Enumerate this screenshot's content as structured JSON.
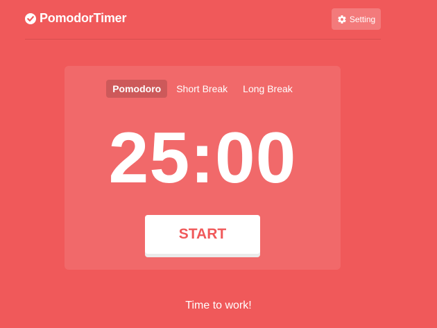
{
  "app": {
    "name": "PomodorTimer",
    "logo_icon": "check-circle-icon"
  },
  "header": {
    "settings_label": "Setting",
    "settings_icon": "gear-icon"
  },
  "tabs": [
    {
      "label": "Pomodoro",
      "active": true
    },
    {
      "label": "Short Break",
      "active": false
    },
    {
      "label": "Long Break",
      "active": false
    }
  ],
  "timer": {
    "display": "25:00"
  },
  "controls": {
    "start_label": "START"
  },
  "status": {
    "message": "Time to work!"
  },
  "colors": {
    "background": "#F0595A",
    "button_text": "#F0595A",
    "button_bg": "#FFFFFF"
  }
}
